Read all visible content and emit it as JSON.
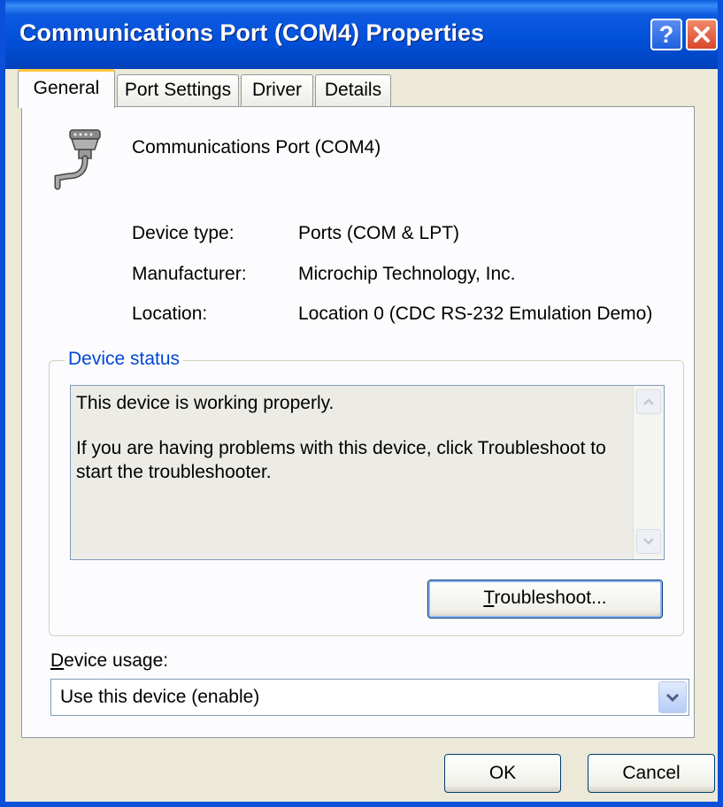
{
  "window": {
    "title": "Communications Port (COM4) Properties",
    "help_glyph": "?"
  },
  "tabs": [
    {
      "label": "General",
      "active": true
    },
    {
      "label": "Port Settings",
      "active": false
    },
    {
      "label": "Driver",
      "active": false
    },
    {
      "label": "Details",
      "active": false
    }
  ],
  "device": {
    "icon": "serial-port-icon",
    "name": "Communications Port (COM4)",
    "properties": [
      {
        "label": "Device type:",
        "value": "Ports (COM & LPT)"
      },
      {
        "label": "Manufacturer:",
        "value": "Microchip Technology, Inc."
      },
      {
        "label": "Location:",
        "value": "Location 0 (CDC RS-232 Emulation Demo)"
      }
    ]
  },
  "status": {
    "group_label": "Device status",
    "line1": "This device is working properly.",
    "line2": "If you are having problems with this device, click Troubleshoot to start the troubleshooter.",
    "troubleshoot_mnemonic": "T",
    "troubleshoot_rest": "roubleshoot..."
  },
  "usage": {
    "label_mnemonic": "D",
    "label_rest": "evice usage:",
    "selected": "Use this device (enable)"
  },
  "buttons": {
    "ok": "OK",
    "cancel": "Cancel"
  },
  "colors": {
    "titlebar": "#0250d8",
    "dialog_bg": "#ece9d8",
    "group_label": "#0046d5",
    "active_tab_accent": "#ffc83c"
  }
}
